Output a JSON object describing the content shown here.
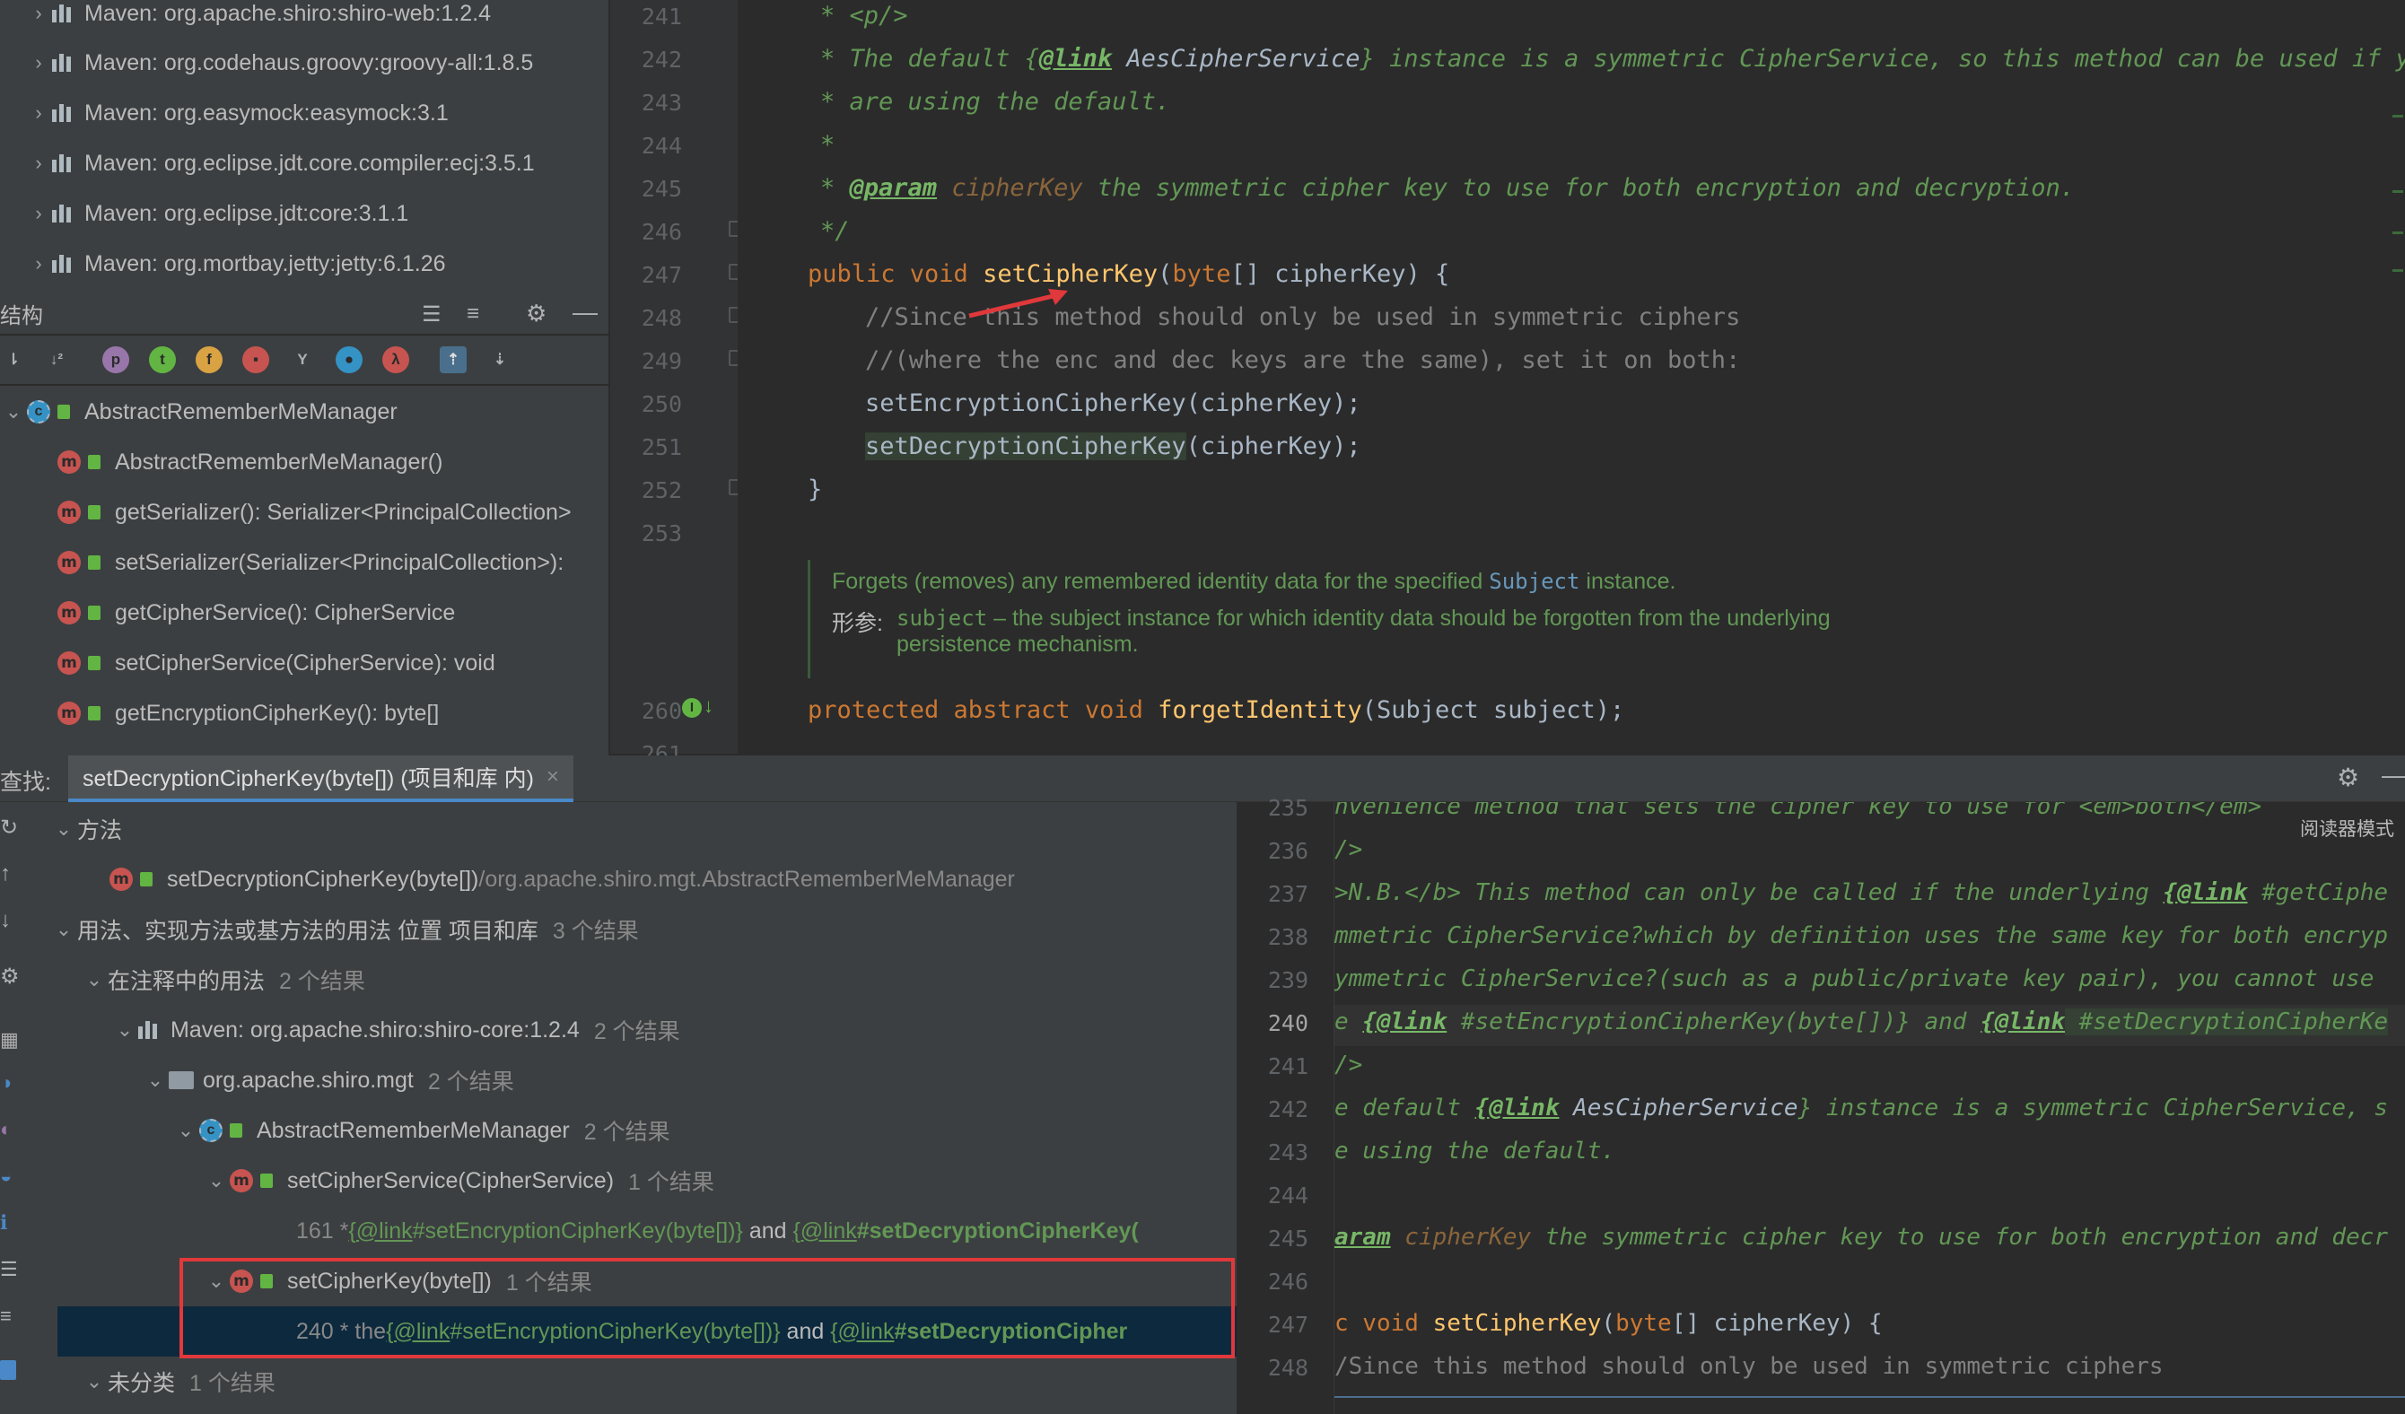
{
  "project_tree": {
    "items": [
      {
        "label": "Maven: org.apache.shiro:shiro-web:1.2.4"
      },
      {
        "label": "Maven: org.codehaus.groovy:groovy-all:1.8.5"
      },
      {
        "label": "Maven: org.easymock:easymock:3.1"
      },
      {
        "label": "Maven: org.eclipse.jdt.core.compiler:ecj:3.5.1"
      },
      {
        "label": "Maven: org.eclipse.jdt:core:3.1.1"
      },
      {
        "label": "Maven: org.mortbay.jetty:jetty:6.1.26"
      }
    ]
  },
  "structure": {
    "title": "结构",
    "toolbar_icons": [
      "sort-visibility-icon",
      "sort-alpha-icon",
      "p-filter-icon",
      "t-filter-icon",
      "f-filter-icon",
      "lock-filter-icon",
      "inherited-icon",
      "circle-icon",
      "lambda-icon",
      "expand-icon",
      "collapse-icon"
    ],
    "root": "AbstractRememberMeManager",
    "members": [
      "AbstractRememberMeManager()",
      "getSerializer(): Serializer<PrincipalCollection>",
      "setSerializer(Serializer<PrincipalCollection>):",
      "getCipherService(): CipherService",
      "setCipherService(CipherService): void",
      "getEncryptionCipherKey(): byte[]"
    ]
  },
  "editor_top": {
    "line_numbers": [
      "241",
      "242",
      "243",
      "244",
      "245",
      "246",
      "247",
      "248",
      "249",
      "250",
      "251",
      "252",
      "253",
      "260",
      "261"
    ],
    "lines": {
      "l241": "* <p/>",
      "l242_a": "* The default {",
      "l242_tag": "@link",
      "l242_ref": " AesCipherService",
      "l242_b": "} instance is a symmetric CipherService, so this method can be used if you",
      "l243": "* are using the default.",
      "l244": "*",
      "l245_a": "* ",
      "l245_tag": "@param",
      "l245_par": " cipherKey",
      "l245_b": " the symmetric cipher key to use for both encryption and decryption.",
      "l246": "*/",
      "l247_kw": "public void ",
      "l247_fn": "setCipherKey",
      "l247_p1": "(",
      "l247_kw2": "byte",
      "l247_p2": "[] cipherKey) {",
      "l248": "//Since this method should only be used in symmetric ciphers",
      "l249": "//(where the enc and dec keys are the same), set it on both:",
      "l250": "setEncryptionCipherKey(cipherKey);",
      "l251_fn": "setDecryptionCipherKey",
      "l251_rest": "(cipherKey);",
      "l252": "}",
      "doc_a": "Forgets (removes) any remembered identity data for the specified ",
      "doc_link": "Subject",
      "doc_b": " instance.",
      "doc_param_label": "形参:",
      "doc_param_name": "subject",
      "doc_param_text": " – the subject instance for which identity data should be forgotten from the underlying",
      "doc_param_text2": "persistence mechanism.",
      "l260_kw": "protected abstract void ",
      "l260_fn": "forgetIdentity",
      "l260_rest": "(Subject subject);"
    }
  },
  "find_panel": {
    "label": "查找:",
    "tab": "setDecryptionCipherKey(byte[]) (项目和库 内)",
    "tab_close": "×",
    "reader_mode": "阅读器模式",
    "tree": {
      "methods_group": "方法",
      "method_item": "setDecryptionCipherKey(byte[])",
      "method_path": " /org.apache.shiro.mgt.AbstractRememberMeManager",
      "usages_group": "用法、实现方法或基方法的用法 位置 项目和库",
      "usages_count": "3 个结果",
      "comments_group": "在注释中的用法",
      "comments_count": "2 个结果",
      "maven_item": "Maven: org.apache.shiro:shiro-core:1.2.4",
      "maven_count": "2 个结果",
      "package_item": "org.apache.shiro.mgt",
      "package_count": "2 个结果",
      "class_item": "AbstractRememberMeManager",
      "class_count": "2 个结果",
      "method1": "setCipherService(CipherService)",
      "method1_count": "1 个结果",
      "usage1_a": "161 * ",
      "usage1_link1": "{@link",
      "usage1_b": " #setEncryptionCipherKey(byte[])}",
      "usage1_c": " and ",
      "usage1_link2": "{@link",
      "usage1_d": " #setDecryptionCipherKey(",
      "method2": "setCipherKey(byte[])",
      "method2_count": "1 个结果",
      "usage2_a": "240 * the ",
      "usage2_link1": "{@link",
      "usage2_b": " #setEncryptionCipherKey(byte[])}",
      "usage2_c": " and ",
      "usage2_link2": "{@link",
      "usage2_d": " #setDecryptionCipher",
      "uncategorized": "未分类",
      "uncategorized_count": "1 个结果"
    }
  },
  "editor_bottom": {
    "line_numbers": [
      "235",
      "236",
      "237",
      "238",
      "239",
      "240",
      "241",
      "242",
      "243",
      "244",
      "245",
      "246",
      "247",
      "248"
    ],
    "lines": {
      "b235": "nvenience method that sets the cipher key to use for <em>both</em> ",
      "b236": "/>",
      "b237_a": ">N.B.</b> This method can only be called if the underlying ",
      "b237_tag": "{@link",
      "b237_b": " #getCiphe",
      "b238": "mmetric CipherService?which by definition uses the same key for both encryp",
      "b239": "ymmetric CipherService?(such as a public/private key pair), you cannot use",
      "b240_a": "e ",
      "b240_tag1": "{@link",
      "b240_b": " #setEncryptionCipherKey(byte[])}",
      "b240_c": " and ",
      "b240_tag2": "{@link",
      "b240_d": " #setDecryptionCipherKe",
      "b241": "/>",
      "b242_a": "e default ",
      "b242_tag": "{@link",
      "b242_ref": " AesCipherService",
      "b242_b": "} instance is a symmetric CipherService, s",
      "b243": "e using the default.",
      "b245_tag": "aram",
      "b245_par": " cipherKey",
      "b245_b": " the symmetric cipher key to use for both encryption and decr",
      "b247_kw": "c void ",
      "b247_fn": "setCipherKey",
      "b247_p1": "(",
      "b247_kw2": "byte",
      "b247_p2": "[] cipherKey) {",
      "b248": "/Since this method should only be used in symmetric ciphers"
    }
  },
  "colors": {
    "accent_red": "#e0383b",
    "selection": "#0d293e",
    "comment_green": "#629755",
    "keyword_orange": "#cc7832",
    "method_yellow": "#ffc66d"
  }
}
